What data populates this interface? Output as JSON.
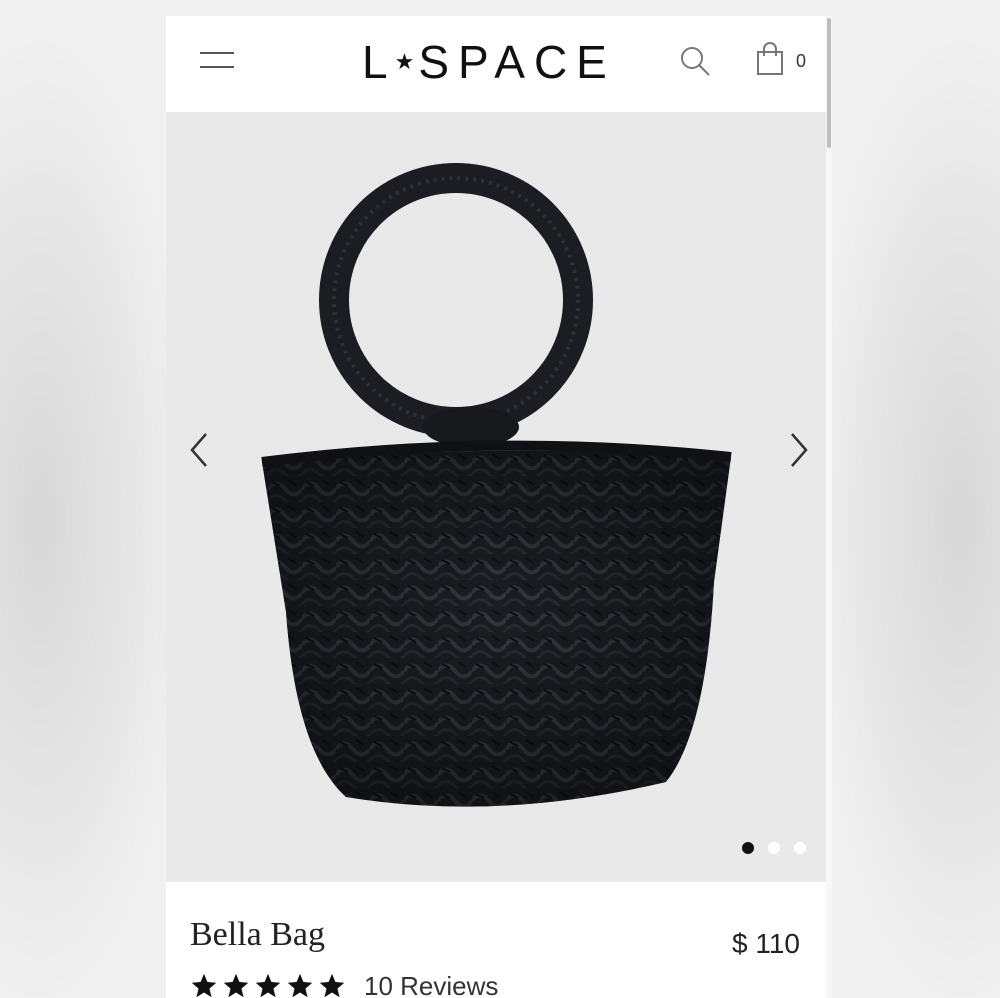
{
  "header": {
    "logo_text": "L★SPACE",
    "logo_left": "L",
    "logo_star": "★",
    "logo_right": "SPACE",
    "cart_count": "0"
  },
  "gallery": {
    "image_subject": "black woven bucket bag with round handle",
    "slide_count": 3,
    "active_slide": 1
  },
  "product": {
    "name": "Bella Bag",
    "price": "$ 110",
    "rating": 5,
    "reviews_label": "10 Reviews"
  },
  "icons": [
    "menu-icon",
    "search-icon",
    "shopping-bag-icon",
    "chevron-left-icon",
    "chevron-right-icon",
    "star-icon"
  ],
  "colors": {
    "background": "#ffffff",
    "gallery_bg": "#e9e9e9",
    "text": "#222222",
    "bag": "#1b1d22"
  }
}
